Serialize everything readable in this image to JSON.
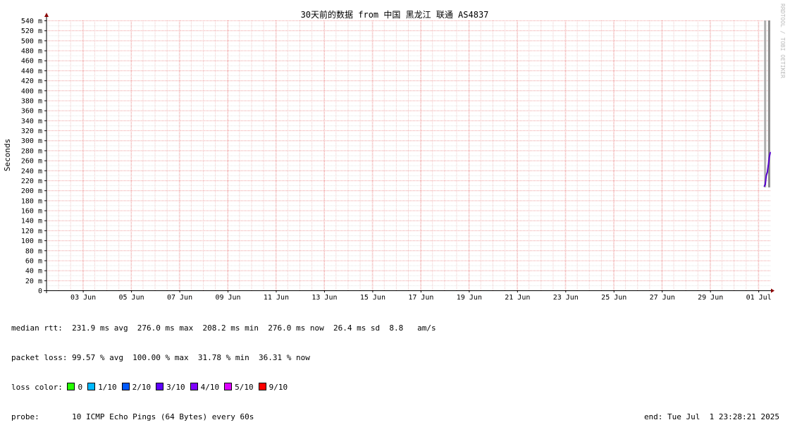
{
  "chart_data": {
    "type": "line",
    "title": "30天前的数据 from 中国 黑龙江 联通 AS4837",
    "ylabel": "Seconds",
    "xlabel": "",
    "ylim": [
      0,
      540
    ],
    "xlim": [
      "2025-06-01 23:28",
      "2025-07-01 23:28"
    ],
    "grid": true,
    "y_ticks": [
      "0",
      "20 m",
      "40 m",
      "60 m",
      "80 m",
      "100 m",
      "120 m",
      "140 m",
      "160 m",
      "180 m",
      "200 m",
      "220 m",
      "240 m",
      "260 m",
      "280 m",
      "300 m",
      "320 m",
      "340 m",
      "360 m",
      "380 m",
      "400 m",
      "420 m",
      "440 m",
      "460 m",
      "480 m",
      "500 m",
      "520 m",
      "540 m"
    ],
    "y_tick_values": [
      0,
      20,
      40,
      60,
      80,
      100,
      120,
      140,
      160,
      180,
      200,
      220,
      240,
      260,
      280,
      300,
      320,
      340,
      360,
      380,
      400,
      420,
      440,
      460,
      480,
      500,
      520,
      540
    ],
    "x_ticks": [
      {
        "label": "03 Jun",
        "date": "2025-06-03 12:00"
      },
      {
        "label": "05 Jun",
        "date": "2025-06-05 12:00"
      },
      {
        "label": "07 Jun",
        "date": "2025-06-07 12:00"
      },
      {
        "label": "09 Jun",
        "date": "2025-06-09 12:00"
      },
      {
        "label": "11 Jun",
        "date": "2025-06-11 12:00"
      },
      {
        "label": "13 Jun",
        "date": "2025-06-13 12:00"
      },
      {
        "label": "15 Jun",
        "date": "2025-06-15 12:00"
      },
      {
        "label": "17 Jun",
        "date": "2025-06-17 12:00"
      },
      {
        "label": "19 Jun",
        "date": "2025-06-19 12:00"
      },
      {
        "label": "21 Jun",
        "date": "2025-06-21 12:00"
      },
      {
        "label": "23 Jun",
        "date": "2025-06-23 12:00"
      },
      {
        "label": "25 Jun",
        "date": "2025-06-25 12:00"
      },
      {
        "label": "27 Jun",
        "date": "2025-06-27 12:00"
      },
      {
        "label": "29 Jun",
        "date": "2025-06-29 12:00"
      },
      {
        "label": "01 Jul",
        "date": "2025-07-01 12:00"
      }
    ],
    "smoke_band": [
      {
        "x": "2025-07-01 18:00",
        "low": 206,
        "high": 540
      },
      {
        "x": "2025-07-01 22:00",
        "low": 206,
        "high": 540
      }
    ],
    "series": [
      {
        "name": "median rtt",
        "color": "#5500cc",
        "points": [
          {
            "x": "2025-07-01 17:30",
            "y": 208
          },
          {
            "x": "2025-07-01 18:30",
            "y": 212
          },
          {
            "x": "2025-07-01 19:30",
            "y": 230
          },
          {
            "x": "2025-07-01 20:30",
            "y": 236
          },
          {
            "x": "2025-07-01 21:30",
            "y": 250
          },
          {
            "x": "2025-07-01 22:30",
            "y": 266
          },
          {
            "x": "2025-07-01 23:28",
            "y": 276
          }
        ]
      }
    ]
  },
  "watermark": "RRDTOOL / TOBI OETIKER",
  "stats": {
    "median_rtt": "median rtt:  231.9 ms avg  276.0 ms max  208.2 ms min  276.0 ms now  26.4 ms sd  8.8   am/s",
    "packet_loss": "packet loss: 99.57 % avg  100.00 % max  31.78 % min  36.31 % now",
    "loss_color_label": "loss color: ",
    "loss_legend": [
      {
        "label": "0",
        "color": "#26ff00"
      },
      {
        "label": "1/10",
        "color": "#00b8ff"
      },
      {
        "label": "2/10",
        "color": "#0059ff"
      },
      {
        "label": "3/10",
        "color": "#5e00ff"
      },
      {
        "label": "4/10",
        "color": "#7e00ff"
      },
      {
        "label": "5/10",
        "color": "#dd00ff"
      },
      {
        "label": "9/10",
        "color": "#ff0000"
      }
    ],
    "probe": "probe:       10 ICMP Echo Pings (64 Bytes) every 60s",
    "end": "end: Tue Jul  1 23:28:21 2025"
  }
}
